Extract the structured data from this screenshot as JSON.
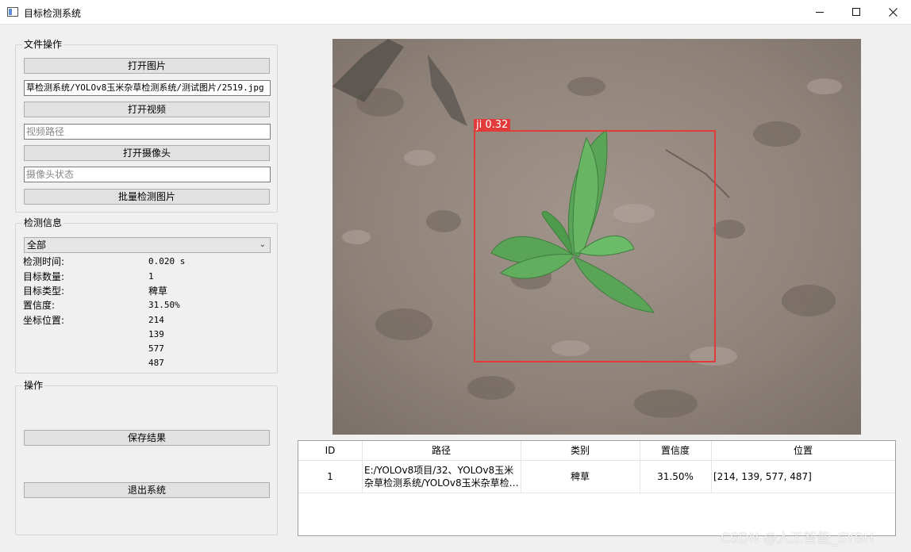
{
  "window": {
    "title": "目标检测系统"
  },
  "file_ops": {
    "title": "文件操作",
    "open_image_label": "打开图片",
    "image_path": "草检测系统/YOLOv8玉米杂草检测系统/测试图片/2519.jpg",
    "open_video_label": "打开视频",
    "video_path_placeholder": "视频路径",
    "open_camera_label": "打开摄像头",
    "camera_status_placeholder": "摄像头状态",
    "batch_detect_label": "批量检测图片"
  },
  "detect_info": {
    "title": "检测信息",
    "target_select": "全部",
    "time_label": "检测时间:",
    "time_value": "0.020 s",
    "count_label": "目标数量:",
    "count_value": "1",
    "type_label": "目标类型:",
    "type_value": "稗草",
    "conf_label": "置信度:",
    "conf_value": "31.50%",
    "coord_label": "坐标位置:",
    "coords": [
      "214",
      "139",
      "577",
      "487"
    ]
  },
  "ops": {
    "title": "操作",
    "save_label": "保存结果",
    "exit_label": "退出系统"
  },
  "detection": {
    "label": "ji 0.32",
    "box_color": "#e23b3b"
  },
  "table": {
    "headers": [
      "ID",
      "路径",
      "类别",
      "置信度",
      "位置"
    ],
    "rows": [
      {
        "id": "1",
        "path": "E:/YOLOv8项目/32、YOLOv8玉米杂草检测系统/YOLOv8玉米杂草检…",
        "category": "稗草",
        "conf": "31.50%",
        "position": "[214, 139, 577, 487]"
      }
    ]
  },
  "watermark": "CSDN @人工智能_SYBH"
}
